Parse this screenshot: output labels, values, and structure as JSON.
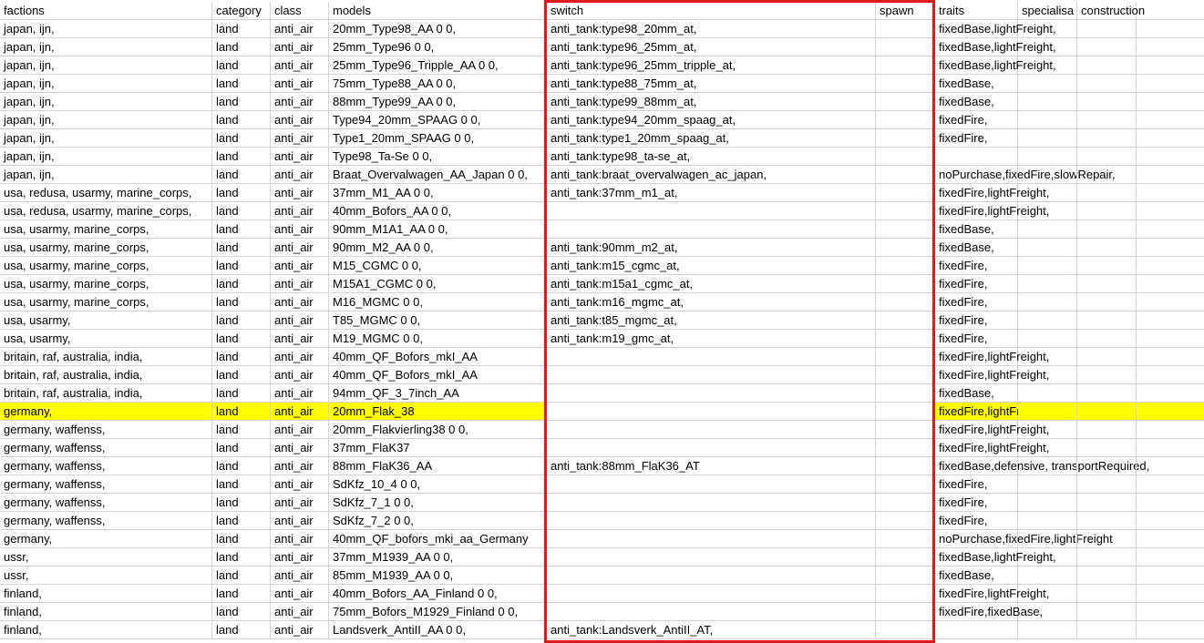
{
  "sheet": {
    "headers": {
      "factions": "factions",
      "category": "category",
      "class": "class",
      "models": "models",
      "switch": "switch",
      "spawn": "spawn",
      "traits": "traits",
      "specialisation": "specialisa",
      "construction": "construction"
    },
    "highlight_color": "#ffff00",
    "selection_border_color": "#e01b1b",
    "rows": [
      {
        "factions": "japan, ijn,",
        "category": "land",
        "class": "anti_air",
        "models": "20mm_Type98_AA 0 0,",
        "switch": "anti_tank:type98_20mm_at,",
        "traits": "fixedBase,lightFreight,"
      },
      {
        "factions": "japan, ijn,",
        "category": "land",
        "class": "anti_air",
        "models": "25mm_Type96 0 0,",
        "switch": "anti_tank:type96_25mm_at,",
        "traits": "fixedBase,lightFreight,"
      },
      {
        "factions": "japan, ijn,",
        "category": "land",
        "class": "anti_air",
        "models": "25mm_Type96_Tripple_AA 0 0,",
        "switch": "anti_tank:type96_25mm_tripple_at,",
        "traits": "fixedBase,lightFreight,"
      },
      {
        "factions": "japan, ijn,",
        "category": "land",
        "class": "anti_air",
        "models": "75mm_Type88_AA 0 0,",
        "switch": "anti_tank:type88_75mm_at,",
        "traits": "fixedBase,"
      },
      {
        "factions": "japan, ijn,",
        "category": "land",
        "class": "anti_air",
        "models": "88mm_Type99_AA 0 0,",
        "switch": "anti_tank:type99_88mm_at,",
        "traits": "fixedBase,"
      },
      {
        "factions": "japan, ijn,",
        "category": "land",
        "class": "anti_air",
        "models": "Type94_20mm_SPAAG 0 0,",
        "switch": "anti_tank:type94_20mm_spaag_at,",
        "traits": "fixedFire,"
      },
      {
        "factions": "japan, ijn,",
        "category": "land",
        "class": "anti_air",
        "models": "Type1_20mm_SPAAG 0 0,",
        "switch": "anti_tank:type1_20mm_spaag_at,",
        "traits": "fixedFire,"
      },
      {
        "factions": "japan, ijn,",
        "category": "land",
        "class": "anti_air",
        "models": "Type98_Ta-Se 0 0,",
        "switch": "anti_tank:type98_ta-se_at,",
        "traits": ""
      },
      {
        "factions": "japan, ijn,",
        "category": "land",
        "class": "anti_air",
        "models": "Braat_Overvalwagen_AA_Japan 0 0,",
        "switch": "anti_tank:braat_overvalwagen_ac_japan,",
        "traits": "noPurchase,fixedFire,slowRepair,"
      },
      {
        "factions": "usa, redusa, usarmy, marine_corps,",
        "category": "land",
        "class": "anti_air",
        "models": "37mm_M1_AA 0 0,",
        "switch": "anti_tank:37mm_m1_at,",
        "traits": "fixedFire,lightFreight,"
      },
      {
        "factions": "usa, redusa, usarmy, marine_corps,",
        "category": "land",
        "class": "anti_air",
        "models": "40mm_Bofors_AA 0 0,",
        "switch": "",
        "traits": "fixedFire,lightFreight,"
      },
      {
        "factions": "usa, usarmy, marine_corps,",
        "category": "land",
        "class": "anti_air",
        "models": "90mm_M1A1_AA 0 0,",
        "switch": "",
        "traits": "fixedBase,"
      },
      {
        "factions": "usa, usarmy, marine_corps,",
        "category": "land",
        "class": "anti_air",
        "models": "90mm_M2_AA 0 0,",
        "switch": "anti_tank:90mm_m2_at,",
        "traits": "fixedBase,"
      },
      {
        "factions": "usa, usarmy, marine_corps,",
        "category": "land",
        "class": "anti_air",
        "models": "M15_CGMC 0 0,",
        "switch": "anti_tank:m15_cgmc_at,",
        "traits": "fixedFire,"
      },
      {
        "factions": "usa, usarmy, marine_corps,",
        "category": "land",
        "class": "anti_air",
        "models": "M15A1_CGMC 0 0,",
        "switch": "anti_tank:m15a1_cgmc_at,",
        "traits": "fixedFire,"
      },
      {
        "factions": "usa, usarmy, marine_corps,",
        "category": "land",
        "class": "anti_air",
        "models": "M16_MGMC 0 0,",
        "switch": "anti_tank:m16_mgmc_at,",
        "traits": "fixedFire,"
      },
      {
        "factions": "usa, usarmy,",
        "category": "land",
        "class": "anti_air",
        "models": "T85_MGMC 0 0,",
        "switch": "anti_tank:t85_mgmc_at,",
        "traits": "fixedFire,"
      },
      {
        "factions": "usa, usarmy,",
        "category": "land",
        "class": "anti_air",
        "models": "M19_MGMC 0 0,",
        "switch": "anti_tank:m19_gmc_at,",
        "traits": "fixedFire,"
      },
      {
        "factions": "britain, raf, australia, india,",
        "category": "land",
        "class": "anti_air",
        "models": "40mm_QF_Bofors_mkI_AA",
        "switch": "",
        "traits": "fixedFire,lightFreight,"
      },
      {
        "factions": "britain, raf, australia, india,",
        "category": "land",
        "class": "anti_air",
        "models": "40mm_QF_Bofors_mkI_AA",
        "switch": "",
        "traits": "fixedFire,lightFreight,"
      },
      {
        "factions": "britain, raf, australia, india,",
        "category": "land",
        "class": "anti_air",
        "models": "94mm_QF_3_7inch_AA",
        "switch": "",
        "traits": "fixedBase,"
      },
      {
        "factions": "germany,",
        "category": "land",
        "class": "anti_air",
        "models": "20mm_Flak_38",
        "switch": "",
        "traits": "fixedFire,lightFreight,noPurchase,NoEditor",
        "highlight": true
      },
      {
        "factions": "germany, waffenss,",
        "category": "land",
        "class": "anti_air",
        "models": "20mm_Flakvierling38 0 0,",
        "switch": "",
        "traits": "fixedFire,lightFreight,"
      },
      {
        "factions": "germany, waffenss,",
        "category": "land",
        "class": "anti_air",
        "models": "37mm_FlaK37",
        "switch": "",
        "traits": "fixedFire,lightFreight,"
      },
      {
        "factions": "germany, waffenss,",
        "category": "land",
        "class": "anti_air",
        "models": "88mm_FlaK36_AA",
        "switch": "anti_tank:88mm_FlaK36_AT",
        "traits": "fixedBase,defensive, transportRequired,"
      },
      {
        "factions": "germany, waffenss,",
        "category": "land",
        "class": "anti_air",
        "models": "SdKfz_10_4 0 0,",
        "switch": "",
        "traits": "fixedFire,"
      },
      {
        "factions": "germany, waffenss,",
        "category": "land",
        "class": "anti_air",
        "models": "SdKfz_7_1 0 0,",
        "switch": "",
        "traits": "fixedFire,"
      },
      {
        "factions": "germany, waffenss,",
        "category": "land",
        "class": "anti_air",
        "models": "SdKfz_7_2 0 0,",
        "switch": "",
        "traits": "fixedFire,"
      },
      {
        "factions": "germany,",
        "category": "land",
        "class": "anti_air",
        "models": "40mm_QF_bofors_mki_aa_Germany",
        "switch": "",
        "traits": "noPurchase,fixedFire,lightFreight"
      },
      {
        "factions": "ussr,",
        "category": "land",
        "class": "anti_air",
        "models": "37mm_M1939_AA 0 0,",
        "switch": "",
        "traits": "fixedBase,lightFreight,"
      },
      {
        "factions": "ussr,",
        "category": "land",
        "class": "anti_air",
        "models": "85mm_M1939_AA 0 0,",
        "switch": "",
        "traits": "fixedBase,"
      },
      {
        "factions": "finland,",
        "category": "land",
        "class": "anti_air",
        "models": "40mm_Bofors_AA_Finland 0 0,",
        "switch": "",
        "traits": "fixedFire,lightFreight,"
      },
      {
        "factions": "finland,",
        "category": "land",
        "class": "anti_air",
        "models": "75mm_Bofors_M1929_Finland 0 0,",
        "switch": "",
        "traits": "fixedFire,fixedBase,"
      },
      {
        "factions": "finland,",
        "category": "land",
        "class": "anti_air",
        "models": "Landsverk_AntiII_AA 0 0,",
        "switch": "anti_tank:Landsverk_AntiII_AT,",
        "traits": ""
      }
    ]
  }
}
